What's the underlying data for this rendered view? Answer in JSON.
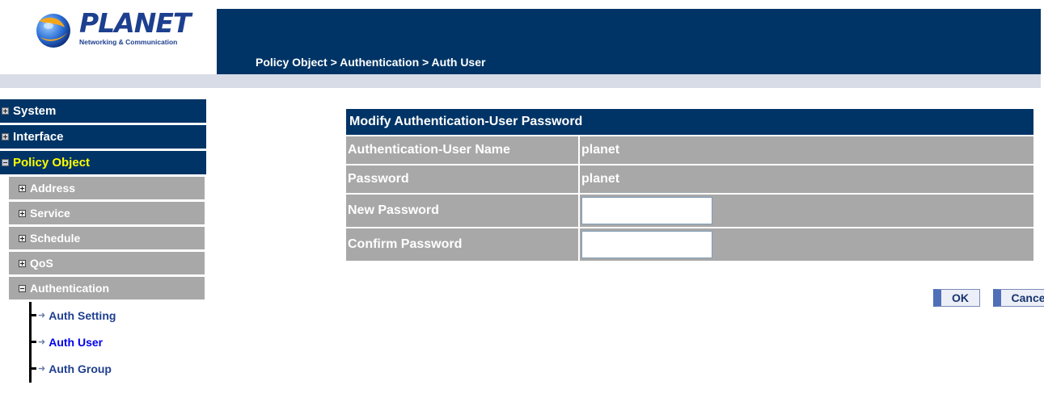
{
  "header": {
    "brand": "PLANET",
    "tagline": "Networking & Communication",
    "breadcrumb": "Policy Object > Authentication > Auth User"
  },
  "sidebar": {
    "main": [
      {
        "label": "System",
        "state": "collapsed"
      },
      {
        "label": "Interface",
        "state": "collapsed"
      },
      {
        "label": "Policy Object",
        "state": "expanded"
      }
    ],
    "sub": [
      {
        "label": "Address",
        "state": "collapsed"
      },
      {
        "label": "Service",
        "state": "collapsed"
      },
      {
        "label": "Schedule",
        "state": "collapsed"
      },
      {
        "label": "QoS",
        "state": "collapsed"
      },
      {
        "label": "Authentication",
        "state": "expanded"
      }
    ],
    "leaves": [
      {
        "label": "Auth Setting"
      },
      {
        "label": "Auth User",
        "active": true
      },
      {
        "label": "Auth Group"
      }
    ]
  },
  "form": {
    "title": "Modify Authentication-User Password",
    "rows": [
      {
        "label": "Authentication-User Name",
        "value": "planet"
      },
      {
        "label": "Password",
        "value": "planet"
      },
      {
        "label": "New Password",
        "value": ""
      },
      {
        "label": "Confirm Password",
        "value": ""
      }
    ]
  },
  "buttons": {
    "ok": "OK",
    "cancel": "Cancel"
  },
  "colors": {
    "header_bg": "#003466",
    "row_bg": "#a8a8a8",
    "active_main": "#ffff00",
    "brand_blue": "#1d3f8f"
  }
}
